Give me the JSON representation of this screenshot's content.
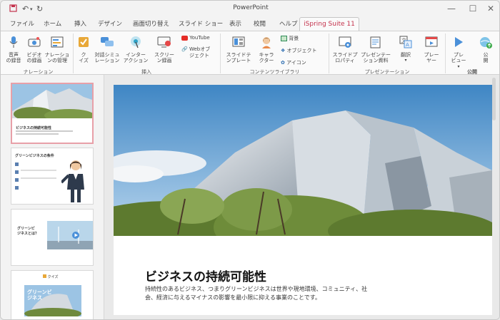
{
  "app": {
    "title": "PowerPoint"
  },
  "window_controls": {
    "minimize": "—",
    "maximize": "☐",
    "close": "✕"
  },
  "tabs": [
    "ファイル",
    "ホーム",
    "挿入",
    "デザイン",
    "画面切り替え",
    "スライド ショー",
    "表示",
    "校閲",
    "ヘルプ",
    "iSpring Suite 11"
  ],
  "ribbon": {
    "narration": {
      "audio": "音声\nの録音",
      "video": "ビデオ\nの録画",
      "manage": "ナレーショ\nンの管理",
      "group": "ナレーション"
    },
    "insert": {
      "quiz": "ク\nイズ",
      "dialog": "対話シミュ\nレーション",
      "interaction": "インター\nアクション",
      "screen": "スクリー\nン録画",
      "youtube": "YouTube",
      "webobj": "Webオブ\nジェクト",
      "group": "挿入"
    },
    "library": {
      "template": "スライドテ\nンプレート",
      "character": "キャラ\nクター",
      "background": "背景",
      "objects": "オブジェクト",
      "icons": "アイコン",
      "group": "コンテンツライブラリ"
    },
    "presentation": {
      "props": "スライドプ\nロパティ",
      "resources": "プレゼンテー\nション資料",
      "translate": "翻訳",
      "player": "プレー\nヤー",
      "group": "プレゼンテーション"
    },
    "publish": {
      "preview": "プレ\nビュー",
      "publish": "公\n開",
      "group": "公開"
    }
  },
  "thumbnails": {
    "t1": {
      "title": "ビジネスの持続可能性"
    },
    "t2": {
      "title": "グリーンビジネスの条件"
    },
    "t3": {
      "title": "グリーンビ\nジネスとは？"
    },
    "t4": {
      "title": "クイズ",
      "overlay": "グリーンビ\nジネス"
    }
  },
  "slide": {
    "title": "ビジネスの持続可能性",
    "body": "持続性のあるビジネス、つまりグリーンビジネスは世界や現地環境、コミュニティ、社会、経済に与えるマイナスの影響を最小限に抑える事業のことです。"
  },
  "colors": {
    "accent": "#c4314b"
  }
}
